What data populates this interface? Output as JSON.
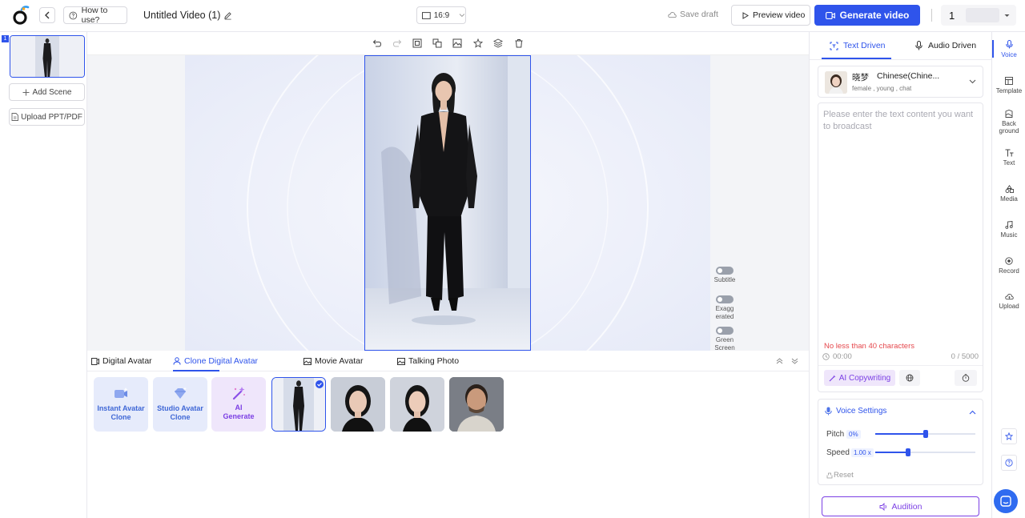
{
  "header": {
    "how_to_use": "How to use?",
    "video_title": "Untitled Video (1)",
    "aspect_ratio": "16:9",
    "save_draft": "Save draft",
    "preview_video": "Preview video",
    "generate_video": "Generate video",
    "account_value": "1"
  },
  "scenes": {
    "scene_number": "1",
    "add_scene": "Add Scene",
    "upload_ppt": "Upload PPT/PDF"
  },
  "canvas_toggles": {
    "subtitle": "Subtitle",
    "exaggerated_1": "Exagg",
    "exaggerated_2": "erated",
    "green_1": "Green",
    "green_2": "Screen"
  },
  "avatar_tabs": [
    {
      "label": "Digital Avatar"
    },
    {
      "label": "Clone Digital Avatar"
    },
    {
      "label": "Movie Avatar"
    },
    {
      "label": "Talking Photo"
    }
  ],
  "avatar_cards": {
    "instant_1": "Instant Avatar",
    "instant_2": "Clone",
    "studio_1": "Studio Avatar",
    "studio_2": "Clone",
    "ai_1": "AI",
    "ai_2": "Generate"
  },
  "right_panel": {
    "tab_text": "Text Driven",
    "tab_audio": "Audio Driven",
    "voice_name": "晓梦",
    "voice_lang": "Chinese(Chine...",
    "voice_tags": "female , young , chat",
    "text_placeholder": "Please enter the text content you want to broadcast",
    "min_chars": "No less than 40 characters",
    "time": "00:00",
    "char_count": "0 / 5000",
    "ai_copywriting": "AI Copywriting",
    "voice_settings": "Voice Settings",
    "pitch_label": "Pitch",
    "pitch_value": "0%",
    "speed_label": "Speed",
    "speed_value": "1.00 x",
    "reset": "Reset",
    "audition": "Audition",
    "pitch_level": 0.5,
    "speed_level": 0.33
  },
  "side_nav": [
    {
      "label": "Voice"
    },
    {
      "label": "Template"
    },
    {
      "label": "Back"
    },
    {
      "label": "ground"
    },
    {
      "label": "Text"
    },
    {
      "label": "Media"
    },
    {
      "label": "Music"
    },
    {
      "label": "Record"
    },
    {
      "label": "Upload"
    }
  ],
  "colors": {
    "accent": "#2f54eb",
    "ai_purple": "#7b3fe4",
    "warning": "#e5484d"
  }
}
